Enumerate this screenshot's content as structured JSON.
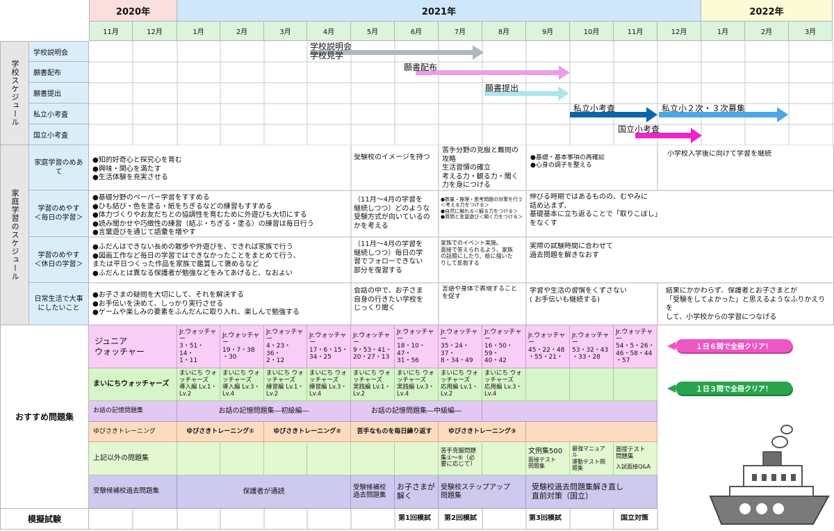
{
  "years": [
    "2020年",
    "2021年",
    "2022年"
  ],
  "months": [
    "11月",
    "12月",
    "1月",
    "2月",
    "3月",
    "4月",
    "5月",
    "6月",
    "7月",
    "8月",
    "9月",
    "10月",
    "11月",
    "12月",
    "1月",
    "2月",
    "3月"
  ],
  "categories": {
    "school": "学校スケジュール",
    "home": "家庭学習のスケジュール",
    "recommend": "おすすめ問題集",
    "mock": "模擬試験"
  },
  "school_rows": [
    "学校説明会",
    "願書配布",
    "願書提出",
    "私立小考査",
    "国立小考査"
  ],
  "school_arrows": [
    {
      "label": "学校説明会\n学校見学",
      "color": "#aab9c2"
    },
    {
      "label": "願書配布",
      "color": "#ee9ce8"
    },
    {
      "label": "願書提出",
      "color": "#aee4ee"
    },
    {
      "label": "私立小考査",
      "color": "#0a66aa"
    },
    {
      "label": "私立小２次・３次募集",
      "color": "#4aa8e6"
    },
    {
      "label": "国立小考査",
      "color": "#ee24c8"
    }
  ],
  "home_rows": [
    "家庭学習のめあて",
    "学習のめやす\n＜毎日の学習＞",
    "学習のめやす\n＜休日の学習＞",
    "日常生活で大事\nにしたいこと"
  ],
  "home_text": [
    [
      "●知的好奇心と探究心を育む\n●興味・関心を満たす\n●生活体験を充実させる",
      "受験校のイメージを持つ",
      "苦手分野の克服と難問の\n攻略\n生活習慣の確立\n考える力・観る力・聞く\n力を身につける",
      "●基礎・基本事項の再確認\n●心身の調子を整える",
      "小学校入学後に向けて学習を継続"
    ],
    [
      "●基礎分野のペーパー学習をすすめる\n●ひも結び・色を塗る・紙をちぎるなどの練習もすすめる\n●体力づくりやお友だちとの協調性を育むために外遊びも大切にする\n●読み聞かせや巧緻性の練習（結ぶ・ちぎる・塗る）の練習は毎日行う\n●言葉遊びを通じて語彙を増やす",
      "（11月～4月の学習を\n継続しつつ）どのような\n受験方式が向いているの\nかを考える",
      "●数量・推理・思考問題の対策を行う\n＜考える力をつける＞\n●自然に触れる＜観る力をつける＞\n●質問と言葉遊び＜聞く力をつける＞",
      "伸びる時期ではあるものの、むやみに\n詰め込まず、\n基礎基本に立ち返ることで「取りこぼし」\nをなくす"
    ],
    [
      "●ふだんはできない長めの散歩や外遊びを、できれば家族で行う\n●図画工作など毎日の学習ではできなかったことをまとめて行う、\nまたは平日つくった作品を家族で鑑賞して褒めるなど\n●ふだんとは異なる保護者が勉強などをみてあげると、なおよい",
      "（11月～4月の学習を\n継続しつつ）毎日の学\n習でフォローできない\n部分を復習する",
      "家族でのイベント実施。\n面接で答えられるよう、家族\nの話題にしたり、絵に描いた\nりして反芻する",
      "実際の試験時間に合わせて\n過去問題を解きなおす"
    ],
    [
      "●お子さまの疑問を大切にして、それを解決する\n●お手伝いを決めて、しっかり実行させる\n●ゲームや楽しみの要素をふんだんに取り入れ、楽しんで勉強する",
      "会話の中で、お子さま\n自身の行きたい学校を\nじっくり聞く",
      "言語や身体で表現すること\nを促す",
      "学習や生活の習慣をくずさない\n( お手伝いも継続する)",
      "結果にかかわらず、保護者とお子さまとが\n「受験をしてよかった」と思えるようなふりかえりを\nして、小学校からの学習につなげる"
    ]
  ],
  "books": {
    "junior": {
      "label": "ジュニア\nウォッチャー",
      "cells": [
        "Jr.ウォッチャー\n3・51・14・\n1・11",
        "Jr.ウォッチャー\n19・7・38\n・30",
        "Jr.ウォッチャー\n4・23・36・\n2・12",
        "Jr.ウォッチャー\n17・6・15・\n34・25",
        "Jr.ウォッチャー\n9・53・41・\n20・27・13",
        "Jr.ウォッチャー\n18・10・47・\n31・56",
        "Jr.ウォッチャー\n35・24・37・\n8・34・49",
        "Jr.ウォッチャー\n16・50・59・\n40・42",
        "Jr.ウォッチャー\n45・22・48\n・55・21・",
        "Jr.ウォッチャー\n53・32・43\n・33・28",
        "Jr.ウォッチャー\n54・5・26・\n46・58・44\n・57"
      ],
      "pill": "１日６問で全冊クリア！"
    },
    "mainichi": {
      "label": "まいにちウォッチャーズ",
      "cells": [
        "まいにち ウォ\nッチャーズ\n導入編 Lv.1・\nLv.2",
        "まいにち ウォ\nッチャーズ\n導入編 Lv.3・\nLv.4",
        "まいにち ウォ\nッチャーズ\n練習編 Lv.1・\nLv.2",
        "まいにち ウォ\nッチャーズ\n練習編 Lv.3・\nLv.4",
        "まいにち ウォ\nッチャーズ\n実践編 Lv.1・\nLv.2",
        "まいにち ウォ\nッチャーズ\n実践編 Lv.3・\nLv.4",
        "まいにち ウォ\nッチャーズ\n応用編 Lv.1・\nLv.2",
        "まいにち ウォ\nッチャーズ\n応用編 Lv.3・\nLv.4"
      ],
      "pill": "１日３問で全冊クリア！"
    },
    "memory": {
      "label": "お話の記憶問題集",
      "cells": [
        "お話の記憶問題集―初級編―",
        "お話の記憶問題集―中級編―"
      ]
    },
    "yubisaki": {
      "label": "ゆびさきトレーニング",
      "cells": [
        "ゆびさきトレーニング①",
        "ゆびさきトレーニング②",
        "苦手なものを毎日繰り返す",
        "ゆびさきトレーニング③"
      ]
    },
    "other": {
      "label": "上記以外の問題集",
      "cells": [
        "苦手克服問題\n集①～⑥（必\n要に応じて）",
        "文例集500",
        "面接テスト\n問題集",
        "最強マニュア\nル\n運動テスト問\n題集",
        "面接テスト\n問題集",
        "入試面接Q&A"
      ]
    },
    "past": {
      "label": "受験候補校過去問題集",
      "cells": [
        "保護者が通読",
        "受験候補校\n過去問題集",
        "お子さまが\n解く",
        "受験校ステップアップ\n問題集",
        "受験校過去問題集解き直し\n直前対策（国立）"
      ]
    }
  },
  "mock": [
    "第1回模試",
    "第2回模試",
    "第3回模試",
    "国立対策"
  ],
  "colors": {
    "year2020": "#fbdede",
    "year2021": "#cfe6fb",
    "year2022": "#fcfbd6",
    "month": "#dcf3dc",
    "label": "#daeefa",
    "category": "#e6e6e6",
    "junior": "#f8cdf6",
    "mainichi": "#d6f5c8",
    "memory": "#e2c9f3",
    "yubisaki": "#fbdcbe",
    "other": "#e3f7d1",
    "past": "#cdc9ef",
    "pill1": "#ee56c4",
    "pill2": "#27a44c"
  }
}
